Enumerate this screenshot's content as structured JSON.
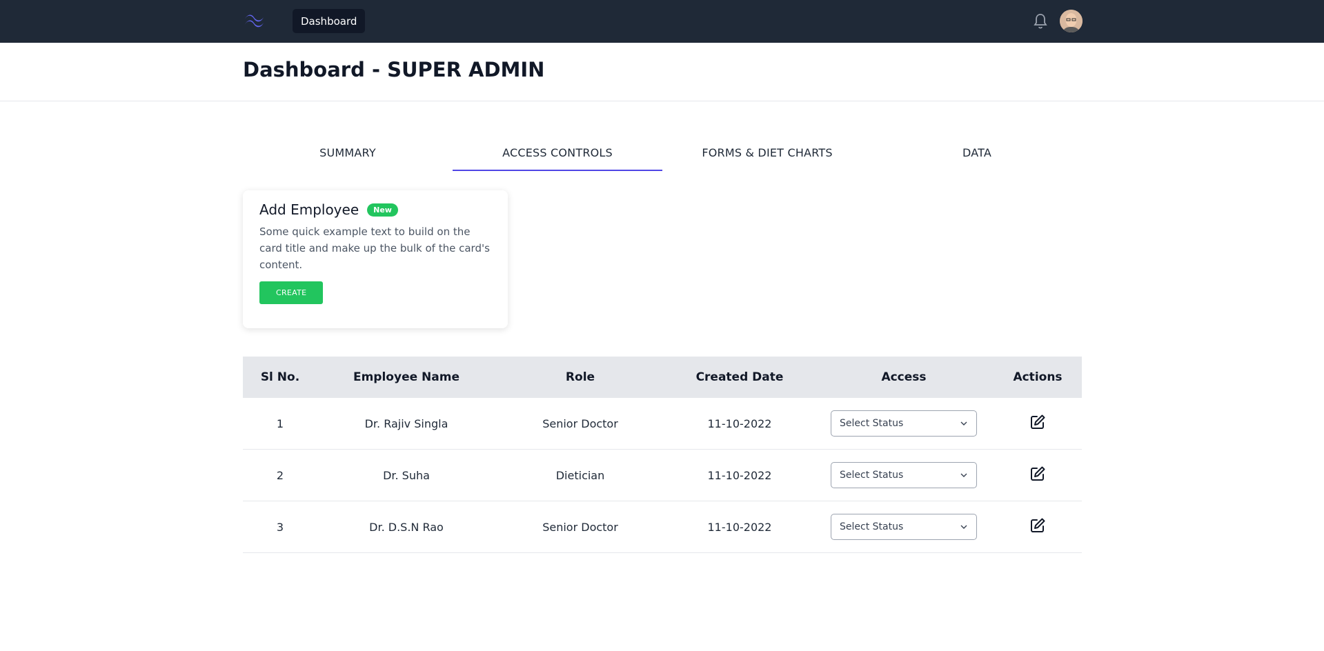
{
  "nav": {
    "dashboard_label": "Dashboard",
    "logo_icon": "tailwind-logo-icon",
    "bell_icon": "bell-icon",
    "accent_color": "#6366f1"
  },
  "header": {
    "title": "Dashboard - SUPER ADMIN"
  },
  "tabs": [
    {
      "label": "SUMMARY",
      "active": false
    },
    {
      "label": "ACCESS CONTROLS",
      "active": true
    },
    {
      "label": "FORMS & DIET CHARTS",
      "active": false
    },
    {
      "label": "DATA",
      "active": false
    }
  ],
  "card": {
    "title": "Add Employee",
    "badge": "New",
    "text": "Some quick example text to build on the card title and make up the bulk of the card's content.",
    "button": "CREATE",
    "button_color": "#22c55e"
  },
  "table": {
    "headers": [
      "Sl No.",
      "Employee Name",
      "Role",
      "Created Date",
      "Access",
      "Actions"
    ],
    "rows": [
      {
        "sl": "1",
        "name": "Dr. Rajiv Singla",
        "role": "Senior Doctor",
        "date": "11-10-2022",
        "access": "Select Status"
      },
      {
        "sl": "2",
        "name": "Dr. Suha",
        "role": "Dietician",
        "date": "11-10-2022",
        "access": "Select Status"
      },
      {
        "sl": "3",
        "name": "Dr. D.S.N Rao",
        "role": "Senior Doctor",
        "date": "11-10-2022",
        "access": "Select Status"
      }
    ]
  }
}
